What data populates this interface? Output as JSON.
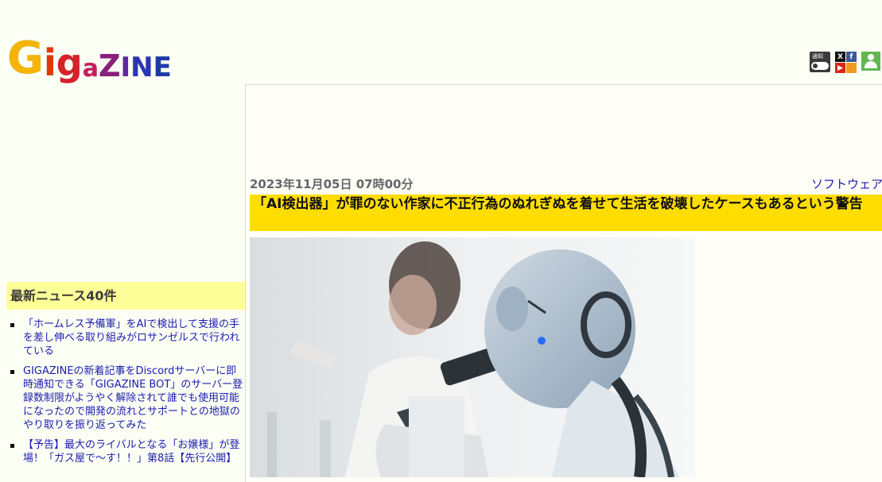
{
  "site": {
    "logo": "GIGAZINE"
  },
  "header": {
    "notify_label": "通知",
    "notify_state": "OFF"
  },
  "social": {
    "x": "X",
    "facebook": "f",
    "youtube": "▶",
    "rss": "RSS"
  },
  "sidebar": {
    "title": "最新ニュース40件",
    "items": [
      {
        "label": "「ホームレス予備軍」をAIで検出して支援の手を差し伸べる取り組みがロサンゼルスで行われている"
      },
      {
        "label": "GIGAZINEの新着記事をDiscordサーバーに即時通知できる「GIGAZINE BOT」のサーバー登録数制限がようやく解除されて誰でも使用可能になったので開発の流れとサポートとの地獄のやり取りを振り返ってみた"
      },
      {
        "label": "【予告】最大のライバルとなる「お嬢様」が登場！「ガス屋で〜す！！」第8話【先行公開】"
      }
    ]
  },
  "article": {
    "date": "2023年11月05日 07時00分",
    "category": "ソフトウェア",
    "title": "「AI検出器」が罪のない作家に不正行為のぬれぎぬを着せて生活を破壊したケースもあるという警告"
  },
  "colors": {
    "accent_yellow": "#ffdd00",
    "sidebar_header": "#ffff99",
    "link": "#1b1bb0",
    "background": "#fcfff4"
  }
}
